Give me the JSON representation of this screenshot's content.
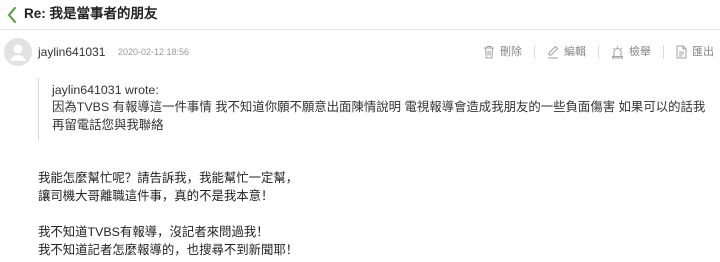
{
  "colors": {
    "accent": "#4f9d3a",
    "icon": "#a0a0a0",
    "muted_text": "#888888"
  },
  "header": {
    "back_icon": "chevron-left-icon",
    "title": "Re: 我是當事者的朋友"
  },
  "post": {
    "avatar_icon": "user-avatar-icon",
    "author": "jaylin641031",
    "date": "2020-02-12 18:56",
    "actions": [
      {
        "label": "刪除",
        "icon": "trash-icon"
      },
      {
        "label": "編輯",
        "icon": "pencil-icon"
      },
      {
        "label": "檢舉",
        "icon": "alarm-icon"
      },
      {
        "label": "匯出",
        "icon": "export-document-icon"
      }
    ],
    "quote": {
      "author_line": "jaylin641031 wrote:",
      "lines": [
        "因為TVBS 有報導這一件事情 我不知道你願不願意出面陳情說明 電視報導會造成我朋友的一些負面傷害 如果可以的話我",
        "再留電話您與我聯絡"
      ]
    },
    "body": {
      "paragraphs": [
        {
          "lines": [
            "我能怎麼幫忙呢？請告訴我，我能幫忙一定幫，",
            "讓司機大哥離職這件事，真的不是我本意！"
          ]
        },
        {
          "lines": [
            "我不知道TVBS有報導，沒記者來問過我！",
            "我不知道記者怎麼報導的，也搜尋不到新聞耶！"
          ]
        }
      ]
    }
  }
}
